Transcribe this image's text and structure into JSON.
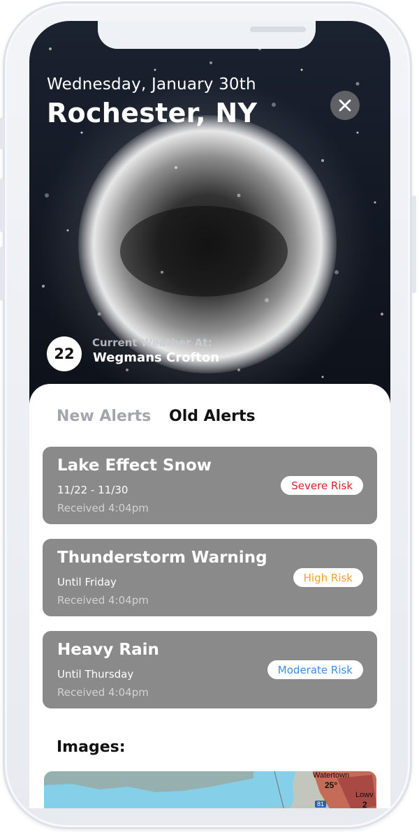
{
  "header": {
    "date": "Wednesday, January 30th",
    "city": "Rochester, NY"
  },
  "current_weather": {
    "temperature": "22",
    "label": "Current Weather At:",
    "location": "Wegmans Crofton"
  },
  "tabs": [
    {
      "label": "New Alerts",
      "active": false
    },
    {
      "label": "Old Alerts",
      "active": true
    }
  ],
  "alerts": [
    {
      "title": "Lake Effect Snow",
      "subtitle": "11/22 - 11/30",
      "received": "Received 4:04pm",
      "risk": "Severe Risk",
      "risk_color": "#e0202a"
    },
    {
      "title": "Thunderstorm Warning",
      "subtitle": "Until Friday",
      "received": "Received 4:04pm",
      "risk": "High Risk",
      "risk_color": "#f5a020"
    },
    {
      "title": "Heavy Rain",
      "subtitle": "Until Thursday",
      "received": "Received 4:04pm",
      "risk": "Moderate Risk",
      "risk_color": "#3c8ce8"
    }
  ],
  "images": {
    "heading": "Images:",
    "map_labels": {
      "city1": "Watertown",
      "temp1": "25°",
      "city2": "Lowv",
      "temp2": "2",
      "route": "81"
    }
  },
  "icons": {
    "close": "close-icon",
    "moon": "snow-moon-image"
  },
  "colors": {
    "card_background": "#8a8a8a",
    "tab_inactive": "#a4a6ab",
    "tab_active": "#111111"
  }
}
